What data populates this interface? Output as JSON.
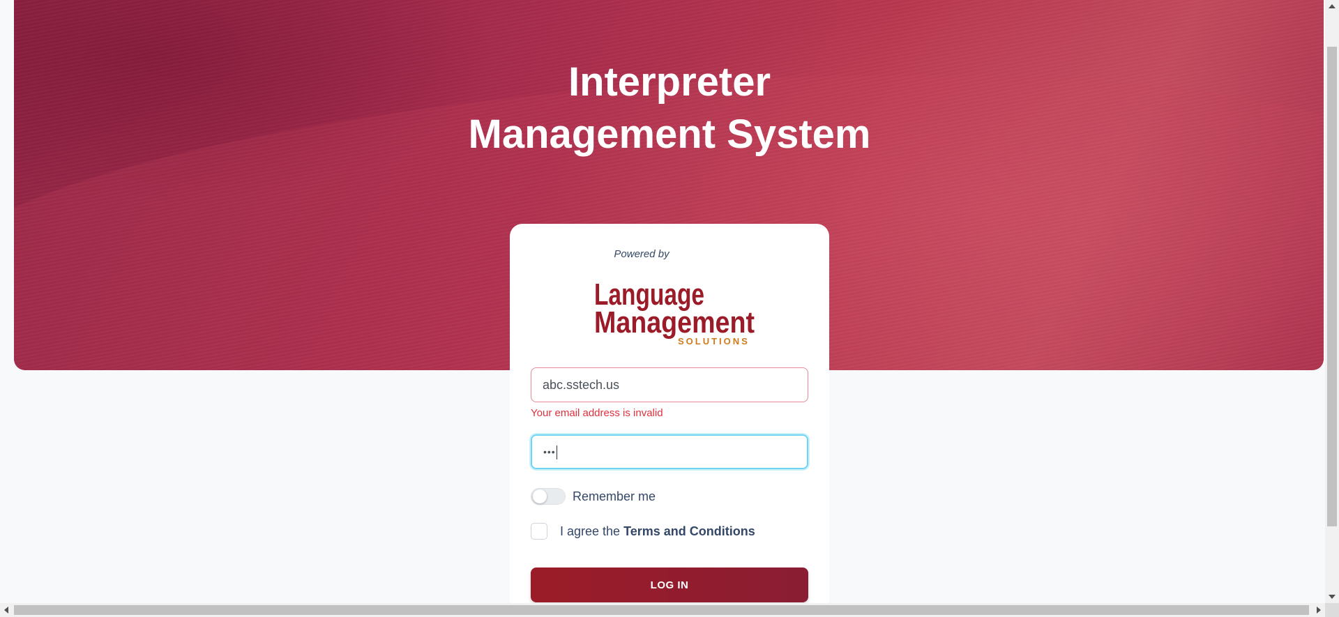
{
  "header": {
    "title_line1": "Interpreter",
    "title_line2": "Management System"
  },
  "login_card": {
    "powered_by": "Powered by",
    "logo": {
      "line1": "Language",
      "line2": "Management",
      "line3": "SOLUTIONS",
      "brand_color": "#9b1c28",
      "accent_color": "#d07a1c"
    },
    "email": {
      "value": "abc.sstech.us",
      "error": "Your email address is invalid"
    },
    "password": {
      "masked_value": "•••"
    },
    "remember_me": {
      "label": "Remember me",
      "checked": false
    },
    "terms": {
      "prefix": "I agree the ",
      "link": "Terms and Conditions",
      "checked": false
    },
    "login_button": "LOG IN"
  },
  "colors": {
    "hero": "#a62b4c",
    "button": "#9b1c28",
    "error": "#e0303c",
    "focus": "#6ed6f4"
  }
}
